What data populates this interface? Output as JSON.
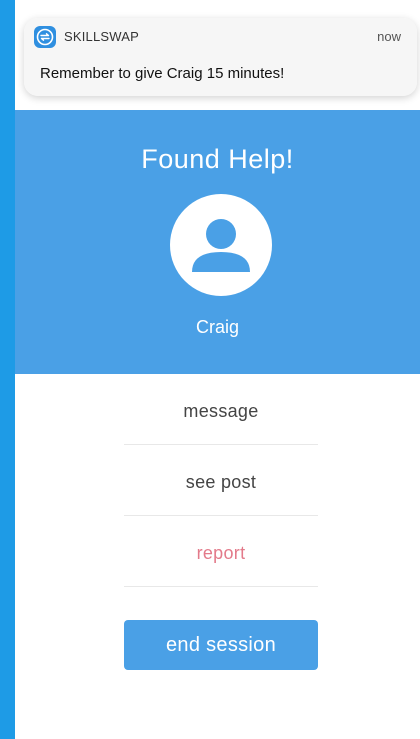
{
  "notification": {
    "app_name": "SKILLSWAP",
    "time": "now",
    "message": "Remember to give Craig 15 minutes!",
    "icon": "skillswap-app-icon"
  },
  "hero": {
    "title": "Found Help!",
    "name": "Craig",
    "avatar_icon": "person-icon"
  },
  "menu": {
    "items": [
      {
        "label": "message"
      },
      {
        "label": "see post"
      },
      {
        "label": "report"
      }
    ]
  },
  "actions": {
    "end_session_label": "end session"
  },
  "colors": {
    "brand_blue": "#4aa0e6",
    "frame_blue": "#1e9be6",
    "danger": "#e37a8a",
    "text": "#444444"
  }
}
